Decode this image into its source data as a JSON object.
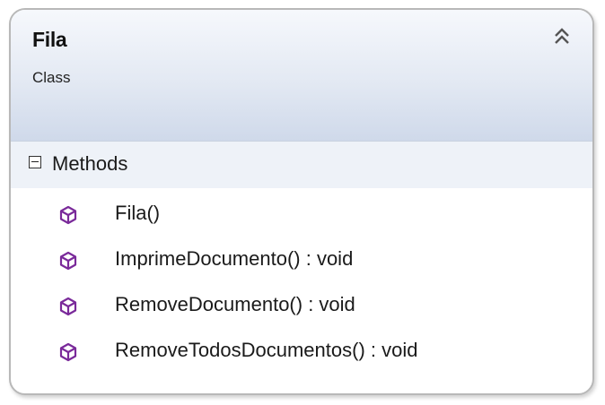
{
  "class": {
    "name": "Fila",
    "kind": "Class"
  },
  "section": {
    "title": "Methods"
  },
  "methods": [
    {
      "label": "Fila()"
    },
    {
      "label": "ImprimeDocumento() : void"
    },
    {
      "label": "RemoveDocumento() : void"
    },
    {
      "label": "RemoveTodosDocumentos() : void"
    }
  ],
  "colors": {
    "method_icon": "#7a2a9a",
    "header_gradient_top": "#f6f8fc",
    "header_gradient_bottom": "#cfd9ea",
    "border": "#b8b8b8"
  },
  "icons": {
    "collapse": "double-chevron-up-icon",
    "section_toggle": "minus-box-icon",
    "method": "method-cube-icon"
  }
}
